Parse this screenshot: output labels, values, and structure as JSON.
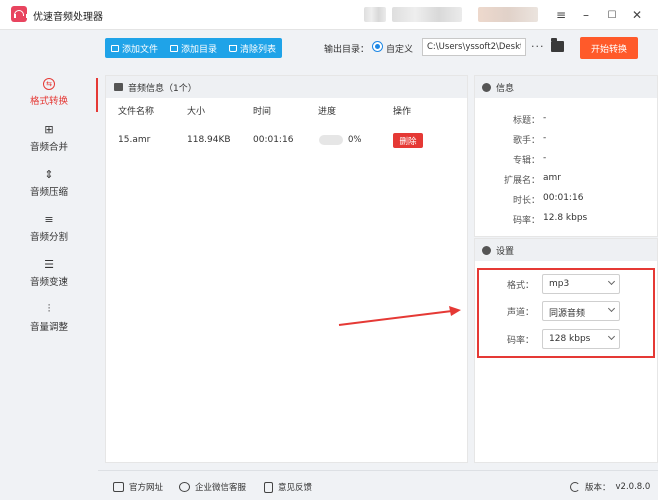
{
  "window": {
    "title": "优速音频处理器",
    "controls": {
      "menu": "≡",
      "minimize": "–",
      "restore": "☐",
      "close": "✕"
    }
  },
  "toolbar": {
    "add_file": "添加文件",
    "add_dir": "添加目录",
    "clear_list": "清除列表",
    "output_dir_label": "输出目录：",
    "custom_option": "自定义",
    "output_path": "C:\\Users\\yssoft2\\Deskt",
    "more": "···",
    "start": "开始转换"
  },
  "sidebar": {
    "items": [
      {
        "label": "格式转换",
        "icon": "convert-icon",
        "active": true
      },
      {
        "label": "音频合并",
        "icon": "merge-icon",
        "active": false
      },
      {
        "label": "音频压缩",
        "icon": "compress-icon",
        "active": false
      },
      {
        "label": "音频分割",
        "icon": "split-icon",
        "active": false
      },
      {
        "label": "音频变速",
        "icon": "speed-icon",
        "active": false
      },
      {
        "label": "音量调整",
        "icon": "volume-icon",
        "active": false
      }
    ]
  },
  "file_panel": {
    "title": "音频信息（1个）",
    "columns": [
      "文件名称",
      "大小",
      "时间",
      "进度",
      "操作"
    ],
    "rows": [
      {
        "name": "15.amr",
        "size": "118.94KB",
        "time": "00:01:16",
        "progress": 0,
        "progress_text": "0%",
        "action": "删除"
      }
    ]
  },
  "info": {
    "title": "信息",
    "rows": [
      {
        "label": "标题：",
        "value": "-"
      },
      {
        "label": "歌手：",
        "value": "-"
      },
      {
        "label": "专辑：",
        "value": "-"
      },
      {
        "label": "扩展名：",
        "value": "amr"
      },
      {
        "label": "时长：",
        "value": "00:01:16"
      },
      {
        "label": "码率：",
        "value": "12.8 kbps"
      }
    ]
  },
  "settings": {
    "title": "设置",
    "format_label": "格式：",
    "format_value": "mp3",
    "channel_label": "声道：",
    "channel_value": "同源音频",
    "bitrate_label": "码率：",
    "bitrate_value": "128 kbps"
  },
  "footer": {
    "website": "官方网址",
    "wechat": "企业微信客服",
    "feedback": "意见反馈",
    "version_label": "版本：",
    "version_value": "v2.0.8.0"
  },
  "colors": {
    "accent_blue": "#1fa3e8",
    "start_orange": "#ff5a2a",
    "active_red": "#e53935",
    "highlight_red": "#e53935"
  }
}
